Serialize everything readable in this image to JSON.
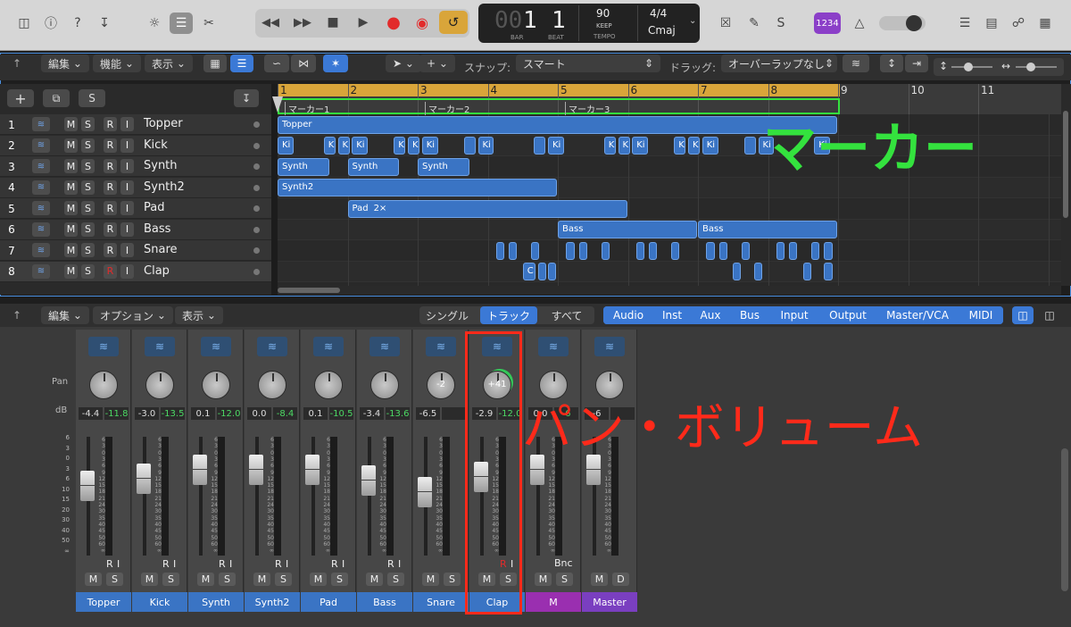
{
  "control_bar": {
    "lcd": {
      "bar": "1",
      "beat": "1",
      "bar_label": "BAR",
      "beat_label": "BEAT",
      "tempo": "90",
      "tempo_mode": "KEEP",
      "tempo_label": "TEMPO",
      "signature": "4/4",
      "key": "Cmaj"
    },
    "counter_badge": "1234"
  },
  "tracks_toolbar": {
    "edit_menu": "編集",
    "function_menu": "機能",
    "view_menu": "表示",
    "snap_label": "スナップ:",
    "snap_value": "スマート",
    "drag_label": "ドラッグ:",
    "drag_value": "オーバーラップなし"
  },
  "track_list_header": {
    "add_label": "+",
    "solo_label": "S"
  },
  "tracks": [
    {
      "num": "1",
      "name": "Topper",
      "m": "M",
      "s": "S",
      "r": "R",
      "i": "I"
    },
    {
      "num": "2",
      "name": "Kick",
      "m": "M",
      "s": "S",
      "r": "R",
      "i": "I"
    },
    {
      "num": "3",
      "name": "Synth",
      "m": "M",
      "s": "S",
      "r": "R",
      "i": "I"
    },
    {
      "num": "4",
      "name": "Synth2",
      "m": "M",
      "s": "S",
      "r": "R",
      "i": "I"
    },
    {
      "num": "5",
      "name": "Pad",
      "m": "M",
      "s": "S",
      "r": "R",
      "i": "I"
    },
    {
      "num": "6",
      "name": "Bass",
      "m": "M",
      "s": "S",
      "r": "R",
      "i": "I"
    },
    {
      "num": "7",
      "name": "Snare",
      "m": "M",
      "s": "S",
      "r": "R",
      "i": "I"
    },
    {
      "num": "8",
      "name": "Clap",
      "m": "M",
      "s": "S",
      "r": "R",
      "i": "I"
    }
  ],
  "ruler": {
    "bars": [
      "1",
      "2",
      "3",
      "4",
      "5",
      "6",
      "7",
      "8",
      "9",
      "10",
      "11"
    ]
  },
  "markers": [
    "マーカー1",
    "マーカー2",
    "マーカー3"
  ],
  "regions": {
    "topper": "Topper",
    "kick": "Ki",
    "kick_short": "K",
    "synth": "Synth",
    "synth2": "Synth2",
    "pad": "Pad",
    "pad_loop": "2×",
    "bass": "Bass",
    "clap": "C"
  },
  "annotations": {
    "marker": "マーカー",
    "pan_volume": "パン・ボリューム"
  },
  "annotation_colors": {
    "green": "#34e23e",
    "red": "#ff2a1a"
  },
  "mixer_toolbar": {
    "edit_menu": "編集",
    "options_menu": "オプション",
    "view_menu": "表示",
    "view_modes": [
      "シングル",
      "トラック",
      "すべて"
    ],
    "filters": [
      "Audio",
      "Inst",
      "Aux",
      "Bus",
      "Input",
      "Output",
      "Master/VCA",
      "MIDI"
    ]
  },
  "mixer": {
    "pan_label": "Pan",
    "db_label": "dB",
    "scale": [
      "6",
      "3",
      "0",
      "3",
      "6",
      "9",
      "12",
      "15",
      "18",
      "21",
      "24",
      "30",
      "35",
      "40",
      "45",
      "50",
      "60",
      "∞"
    ],
    "left_scale": [
      "6",
      "3",
      "0",
      "3",
      "6",
      "10",
      "15",
      "20",
      "30",
      "40",
      "50",
      "∞"
    ],
    "strips": [
      {
        "name": "Topper",
        "pan": "",
        "db1": "-4.4",
        "db2": "-11.8",
        "fader": 0.62,
        "m": "M",
        "s": "S",
        "r": "R",
        "i": "I",
        "color": "#3a74c4"
      },
      {
        "name": "Kick",
        "pan": "",
        "db1": "-3.0",
        "db2": "-13.5",
        "fader": 0.7,
        "m": "M",
        "s": "S",
        "r": "R",
        "i": "I",
        "color": "#3a74c4"
      },
      {
        "name": "Synth",
        "pan": "",
        "db1": "0.1",
        "db2": "-12.0",
        "fader": 0.8,
        "m": "M",
        "s": "S",
        "r": "R",
        "i": "I",
        "color": "#3a74c4"
      },
      {
        "name": "Synth2",
        "pan": "",
        "db1": "0.0",
        "db2": "-8.4",
        "fader": 0.8,
        "m": "M",
        "s": "S",
        "r": "R",
        "i": "I",
        "color": "#3a74c4"
      },
      {
        "name": "Pad",
        "pan": "",
        "db1": "0.1",
        "db2": "-10.5",
        "fader": 0.8,
        "m": "M",
        "s": "S",
        "r": "R",
        "i": "I",
        "color": "#3a74c4"
      },
      {
        "name": "Bass",
        "pan": "",
        "db1": "-3.4",
        "db2": "-13.6",
        "fader": 0.68,
        "m": "M",
        "s": "S",
        "r": "R",
        "i": "I",
        "color": "#3a74c4"
      },
      {
        "name": "Snare",
        "pan": "-2",
        "db1": "-6.5",
        "db2": "",
        "fader": 0.55,
        "m": "M",
        "s": "S",
        "r": "",
        "i": "",
        "color": "#3a74c4"
      },
      {
        "name": "Clap",
        "pan": "+41",
        "db1": "-2.9",
        "db2": "-12.0",
        "fader": 0.72,
        "m": "M",
        "s": "S",
        "r": "R",
        "i": "I",
        "color": "#3a74c4"
      },
      {
        "name": "M",
        "pan": "",
        "db1": "0.0",
        "db2": "-6",
        "fader": 0.8,
        "m": "M",
        "s": "S",
        "r": "",
        "i": "",
        "bnc": "Bnc",
        "color": "#9a2fb0"
      },
      {
        "name": "Master",
        "pan": "",
        "db1": "-6",
        "db2": "",
        "fader": 0.8,
        "m": "M",
        "s": "D",
        "r": "",
        "i": "",
        "color": "#7a3fc0"
      }
    ]
  }
}
